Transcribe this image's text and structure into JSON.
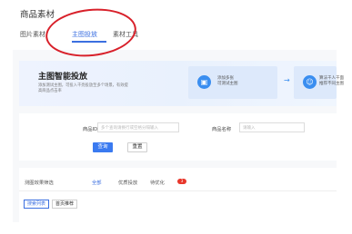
{
  "page_title": "商品素材",
  "tabs": [
    {
      "label": "图片素材"
    },
    {
      "label": "主图投放"
    },
    {
      "label": "素材工具"
    }
  ],
  "banner": {
    "title": "主图智能投放",
    "description": "添加测试主图，可投入千亮投放至多个场景，有效提高商品点击率",
    "step1": "添加多张\n可测试主图",
    "step2": "算法千人千面\n推荐不同主图"
  },
  "filter": {
    "product_id_label": "商品ID",
    "product_id_placeholder": "多个查询请换行或空格分隔输入",
    "product_name_label": "商品名称",
    "product_name_placeholder": "请输入",
    "search_label": "查询",
    "reset_label": "重置"
  },
  "results": {
    "filter_label": "测图效果筛选",
    "tabs": [
      {
        "label": "全部"
      },
      {
        "label": "优质投放"
      },
      {
        "label": "待优化"
      }
    ],
    "badge_count": "3",
    "view_tabs": [
      {
        "label": "搜索列表"
      },
      {
        "label": "首页推荐"
      }
    ]
  },
  "colors": {
    "accent": "#3b6fe0",
    "annotation": "#d8202a",
    "badge": "#e8372c"
  }
}
